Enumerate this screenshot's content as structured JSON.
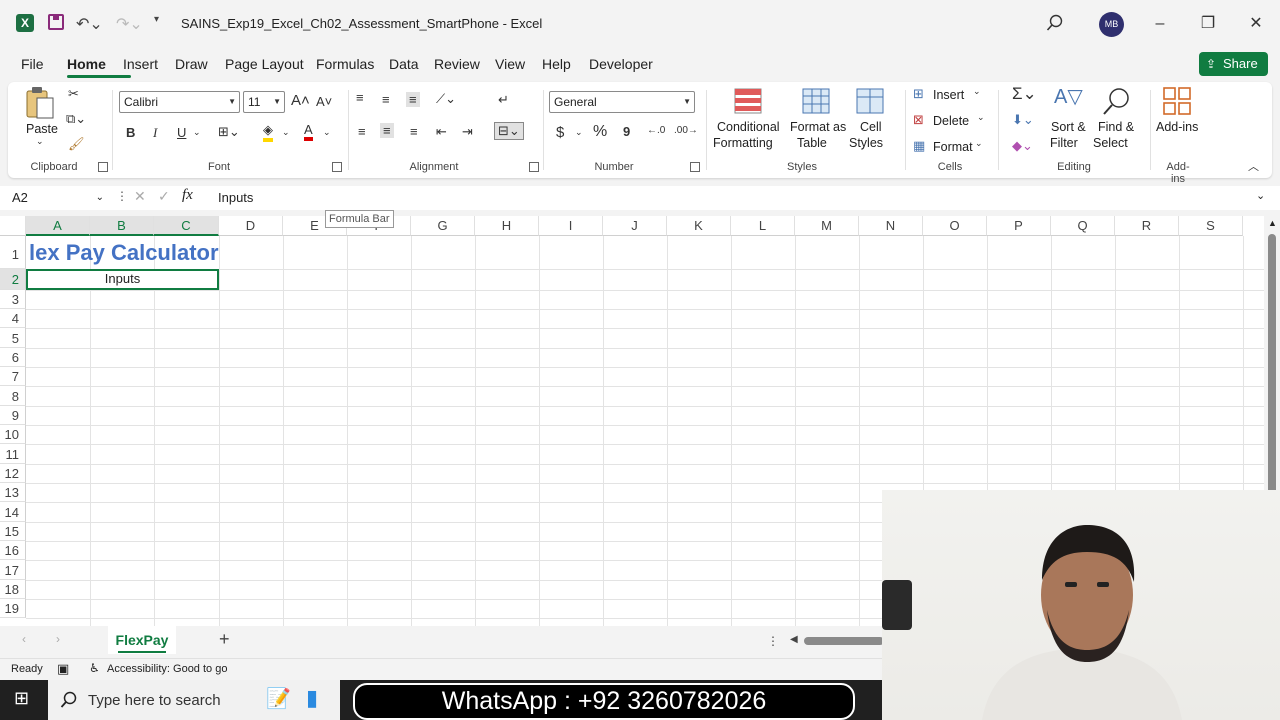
{
  "app": {
    "title": "SAINS_Exp19_Excel_Ch02_Assessment_SmartPhone  -  Excel",
    "logo_letter": "X",
    "user_initials": "MB"
  },
  "menu_tabs": [
    "File",
    "Home",
    "Insert",
    "Draw",
    "Page Layout",
    "Formulas",
    "Data",
    "Review",
    "View",
    "Help",
    "Developer"
  ],
  "share_label": "Share",
  "ribbon": {
    "clipboard": {
      "paste": "Paste",
      "group": "Clipboard"
    },
    "font": {
      "name": "Calibri",
      "size": "11",
      "group": "Font",
      "bold": "B",
      "italic": "I",
      "underline": "U"
    },
    "alignment": {
      "group": "Alignment"
    },
    "number": {
      "format": "General",
      "group": "Number",
      "currency": "$",
      "percent": "%",
      "comma": "9"
    },
    "styles": {
      "conditional": "Conditional",
      "conditional2": "Formatting",
      "format_as": "Format as",
      "format_as2": "Table",
      "cell": "Cell",
      "cell2": "Styles",
      "group": "Styles"
    },
    "cells": {
      "insert": "Insert",
      "delete": "Delete",
      "format": "Format",
      "group": "Cells"
    },
    "editing": {
      "sort": "Sort &",
      "sort2": "Filter",
      "find": "Find &",
      "find2": "Select",
      "group": "Editing"
    },
    "addins": {
      "label": "Add-ins",
      "group": "Add-ins"
    }
  },
  "formula_bar": {
    "name_box": "A2",
    "fx": "fx",
    "content": "Inputs",
    "tooltip": "Formula Bar"
  },
  "columns": [
    "A",
    "B",
    "C",
    "D",
    "E",
    "F",
    "G",
    "H",
    "I",
    "J",
    "K",
    "L",
    "M",
    "N",
    "O",
    "P",
    "Q",
    "R",
    "S"
  ],
  "rows": [
    "1",
    "2",
    "3",
    "4",
    "5",
    "6",
    "7",
    "8",
    "9",
    "10",
    "11",
    "12",
    "13",
    "14",
    "15",
    "16",
    "17",
    "18",
    "19"
  ],
  "cells": {
    "row1": "lex Pay Calculator",
    "row2": "Inputs"
  },
  "sheets": {
    "active": "FlexPay",
    "add": "+"
  },
  "status": {
    "ready": "Ready",
    "accessibility": "Accessibility: Good to go"
  },
  "taskbar": {
    "search_placeholder": "Type here to search"
  },
  "overlay": {
    "whatsapp": "WhatsApp : +92 3260782026"
  }
}
